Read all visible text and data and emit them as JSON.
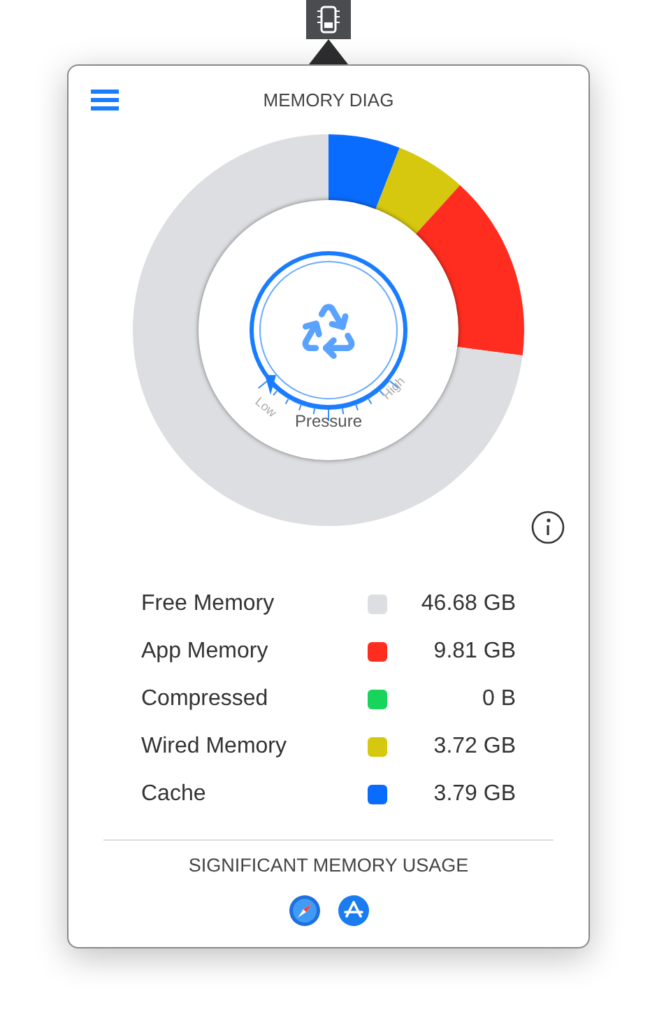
{
  "title": "MEMORY DIAG",
  "chart_data": {
    "type": "donut",
    "categories": [
      "Free Memory",
      "App Memory",
      "Compressed",
      "Wired Memory",
      "Cache"
    ],
    "values": [
      72.94,
      15.33,
      0,
      5.81,
      5.92
    ]
  },
  "pressure": {
    "low": "Low",
    "high": "High",
    "label": "Pressure",
    "level": 0.08
  },
  "legend": [
    {
      "color": "#dcdee2",
      "value": "46.68 GB"
    },
    {
      "color": "#ff2d1f",
      "value": "9.81 GB"
    },
    {
      "color": "#19d45a",
      "value": "0 B"
    },
    {
      "color": "#d6c80e",
      "value": "3.72 GB"
    },
    {
      "color": "#0a6cff",
      "value": "3.79 GB"
    }
  ],
  "significant": {
    "title": "SIGNIFICANT MEMORY USAGE",
    "apps": [
      {
        "kind": "compass"
      },
      {
        "kind": "appstore"
      }
    ]
  }
}
